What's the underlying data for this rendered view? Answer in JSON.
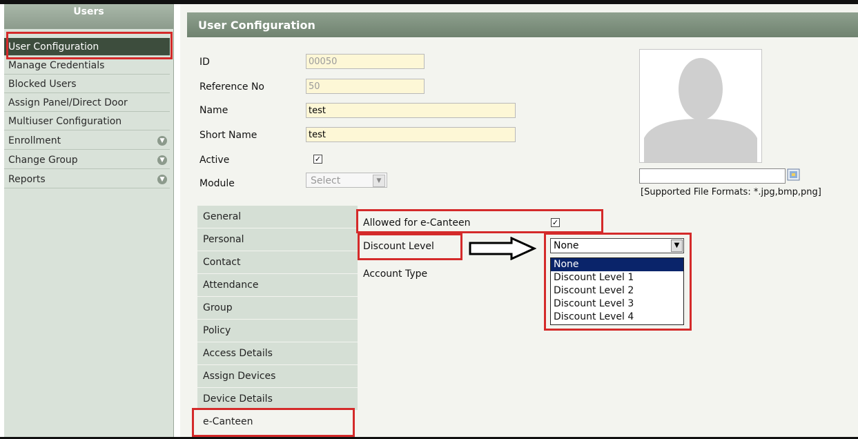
{
  "sidebar": {
    "title": "Users",
    "items": [
      {
        "label": "User Configuration"
      },
      {
        "label": "Manage Credentials"
      },
      {
        "label": "Blocked Users"
      },
      {
        "label": "Assign Panel/Direct Door"
      },
      {
        "label": "Multiuser Configuration"
      },
      {
        "label": "Enrollment"
      },
      {
        "label": "Change Group"
      },
      {
        "label": "Reports"
      }
    ]
  },
  "main": {
    "title": "User Configuration",
    "fields": {
      "id": {
        "label": "ID",
        "value": "00050"
      },
      "reference": {
        "label": "Reference No",
        "value": "50"
      },
      "name": {
        "label": "Name",
        "value": "test"
      },
      "short_name": {
        "label": "Short Name",
        "value": "test"
      },
      "active": {
        "label": "Active",
        "checked": true
      },
      "module": {
        "label": "Module",
        "value": "Select"
      }
    },
    "photo": {
      "formats_text": "[Supported File Formats: *.jpg,bmp,png]"
    },
    "tabs": [
      {
        "label": "General"
      },
      {
        "label": "Personal"
      },
      {
        "label": "Contact"
      },
      {
        "label": "Attendance"
      },
      {
        "label": "Group"
      },
      {
        "label": "Policy"
      },
      {
        "label": "Access Details"
      },
      {
        "label": "Assign Devices"
      },
      {
        "label": "Device Details"
      },
      {
        "label": "e-Canteen"
      }
    ],
    "ecanteen": {
      "allowed_label": "Allowed for e-Canteen",
      "allowed_checked": true,
      "discount_label": "Discount Level",
      "discount_value": "None",
      "account_label": "Account Type",
      "discount_options": [
        "None",
        "Discount Level 1",
        "Discount Level 2",
        "Discount Level 3",
        "Discount Level 4"
      ]
    }
  },
  "colors": {
    "highlight": "#d42a2a",
    "selected_option": "#0a246a"
  }
}
